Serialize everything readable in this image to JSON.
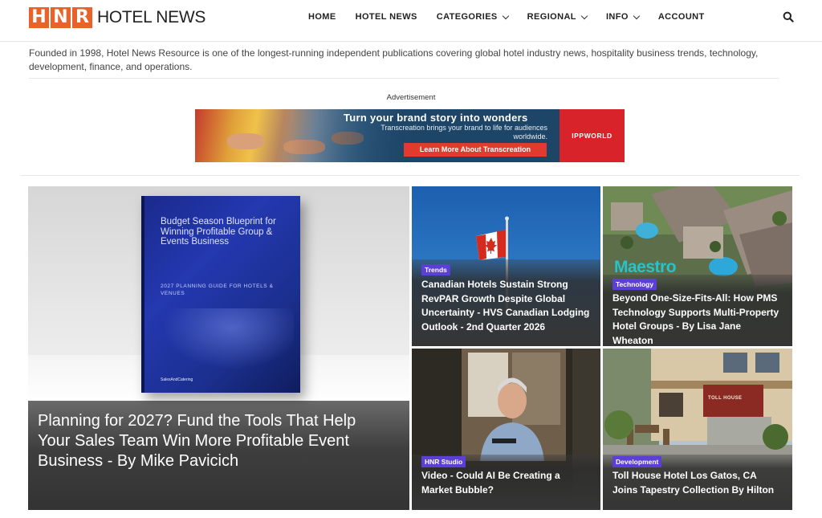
{
  "header": {
    "logo_letters": [
      "H",
      "N",
      "R"
    ],
    "logo_text": "HOTEL NEWS",
    "nav": [
      {
        "label": "HOME",
        "dropdown": false
      },
      {
        "label": "HOTEL NEWS",
        "dropdown": false
      },
      {
        "label": "CATEGORIES",
        "dropdown": true
      },
      {
        "label": "REGIONAL",
        "dropdown": true
      },
      {
        "label": "INFO",
        "dropdown": true
      },
      {
        "label": "ACCOUNT",
        "dropdown": false
      }
    ],
    "search_icon": "search-icon"
  },
  "intro": "Founded in 1998, Hotel News Resource is one of the longest-running independent publications covering global hotel industry news, hospitality business trends, technology, development, finance, and operations.",
  "ad": {
    "label": "Advertisement",
    "title": "Turn your brand story into wonders",
    "subtitle": "Transcreation brings your brand to life for audiences worldwide.",
    "cta": "Learn More About Transcreation",
    "brand": "IPPWORLD"
  },
  "featured": {
    "title": "Planning for 2027? Fund the Tools That Help Your Sales Team Win More Profitable Event Business - By Mike Pavicich",
    "book_title": "Budget Season Blueprint for Winning Profitable Group & Events Business",
    "book_subtitle": "2027 PLANNING GUIDE FOR HOTELS & VENUES",
    "book_logo": "SalesAndCatering"
  },
  "cards": [
    {
      "tag": "Trends",
      "title": "Canadian Hotels Sustain Strong RevPAR Growth Despite Global Uncertainty - HVS Canadian Lodging Outlook - 2nd Quarter 2026"
    },
    {
      "tag": "Technology",
      "title": "Beyond One-Size-Fits-All: How PMS Technology Supports Multi-Property Hotel Groups - By Lisa Jane Wheaton",
      "image_text": "Maestro"
    },
    {
      "tag": "HNR Studio",
      "title": "Video - Could AI Be Creating a Market Bubble?"
    },
    {
      "tag": "Development",
      "title": "Toll House Hotel Los Gatos, CA Joins Tapestry Collection By Hilton",
      "image_text": "TOLL HOUSE"
    }
  ],
  "colors": {
    "logo_orange": "#e8632b",
    "badge_purple": "#5b3fd6",
    "ad_red": "#e23b2d",
    "ad_navy": "#1d4567"
  }
}
